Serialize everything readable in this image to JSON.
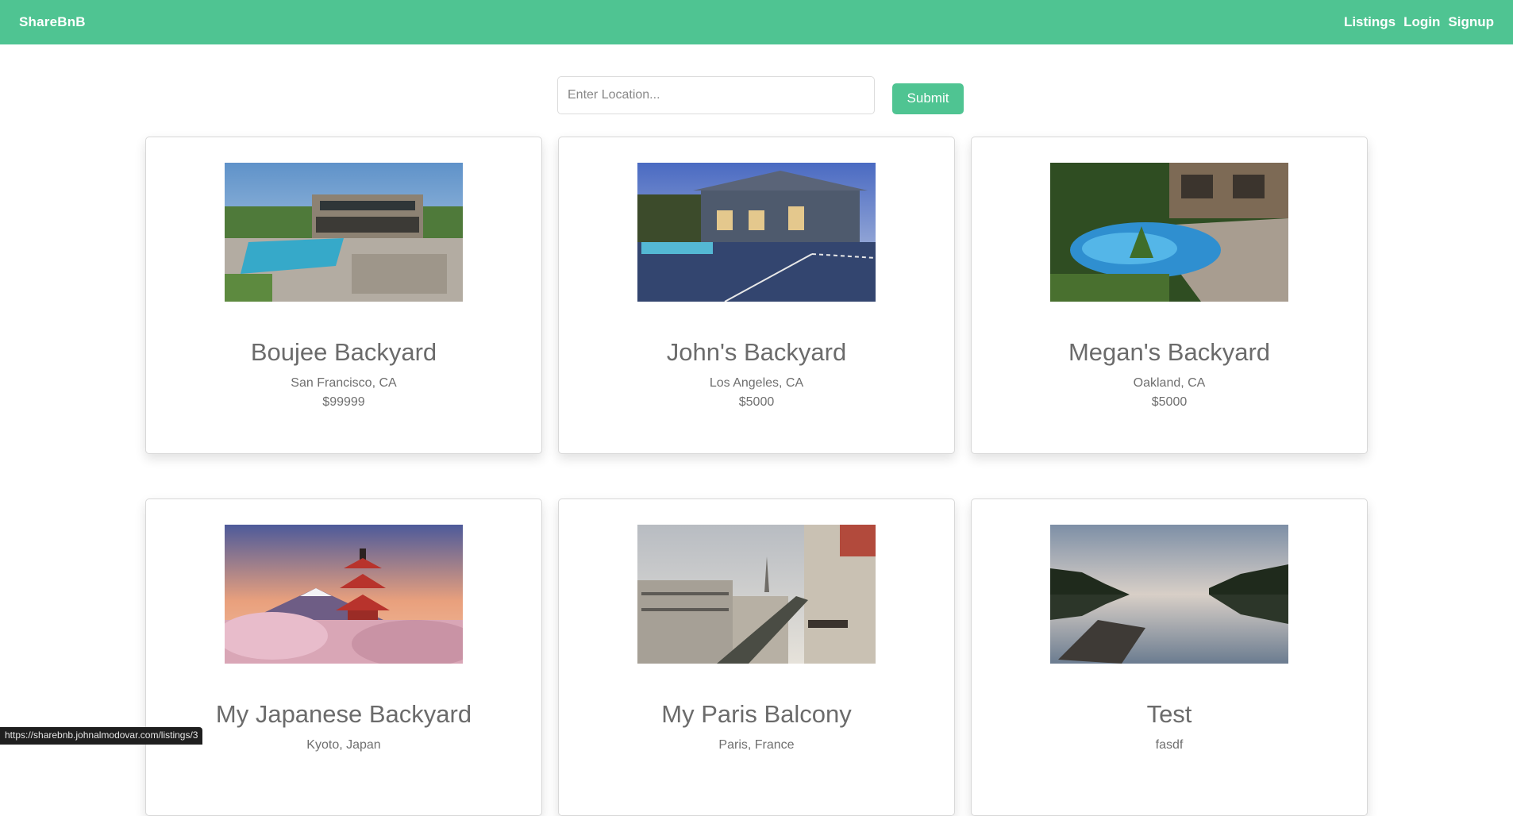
{
  "navbar": {
    "brand": "ShareBnB",
    "links": [
      "Listings",
      "Login",
      "Signup"
    ]
  },
  "search": {
    "placeholder": "Enter Location...",
    "submit_label": "Submit"
  },
  "listings": [
    {
      "title": "Boujee Backyard",
      "location": "San Francisco, CA",
      "price": "$99999",
      "image": "backyard-pool-house-photo"
    },
    {
      "title": "John's Backyard",
      "location": "Los Angeles, CA",
      "price": "$5000",
      "image": "backyard-basketball-court-photo"
    },
    {
      "title": "Megan's Backyard",
      "location": "Oakland, CA",
      "price": "$5000",
      "image": "backyard-lagoon-pool-photo"
    },
    {
      "title": "My Japanese Backyard",
      "location": "Kyoto, Japan",
      "price": "",
      "image": "japanese-pagoda-photo"
    },
    {
      "title": "My Paris Balcony",
      "location": "Paris, France",
      "price": "",
      "image": "paris-balcony-photo"
    },
    {
      "title": "Test",
      "location": "fasdf",
      "price": "",
      "image": "lake-dock-photo"
    }
  ],
  "status_url": "https://sharebnb.johnalmodovar.com/listings/3",
  "colors": {
    "accent": "#4fc492"
  }
}
